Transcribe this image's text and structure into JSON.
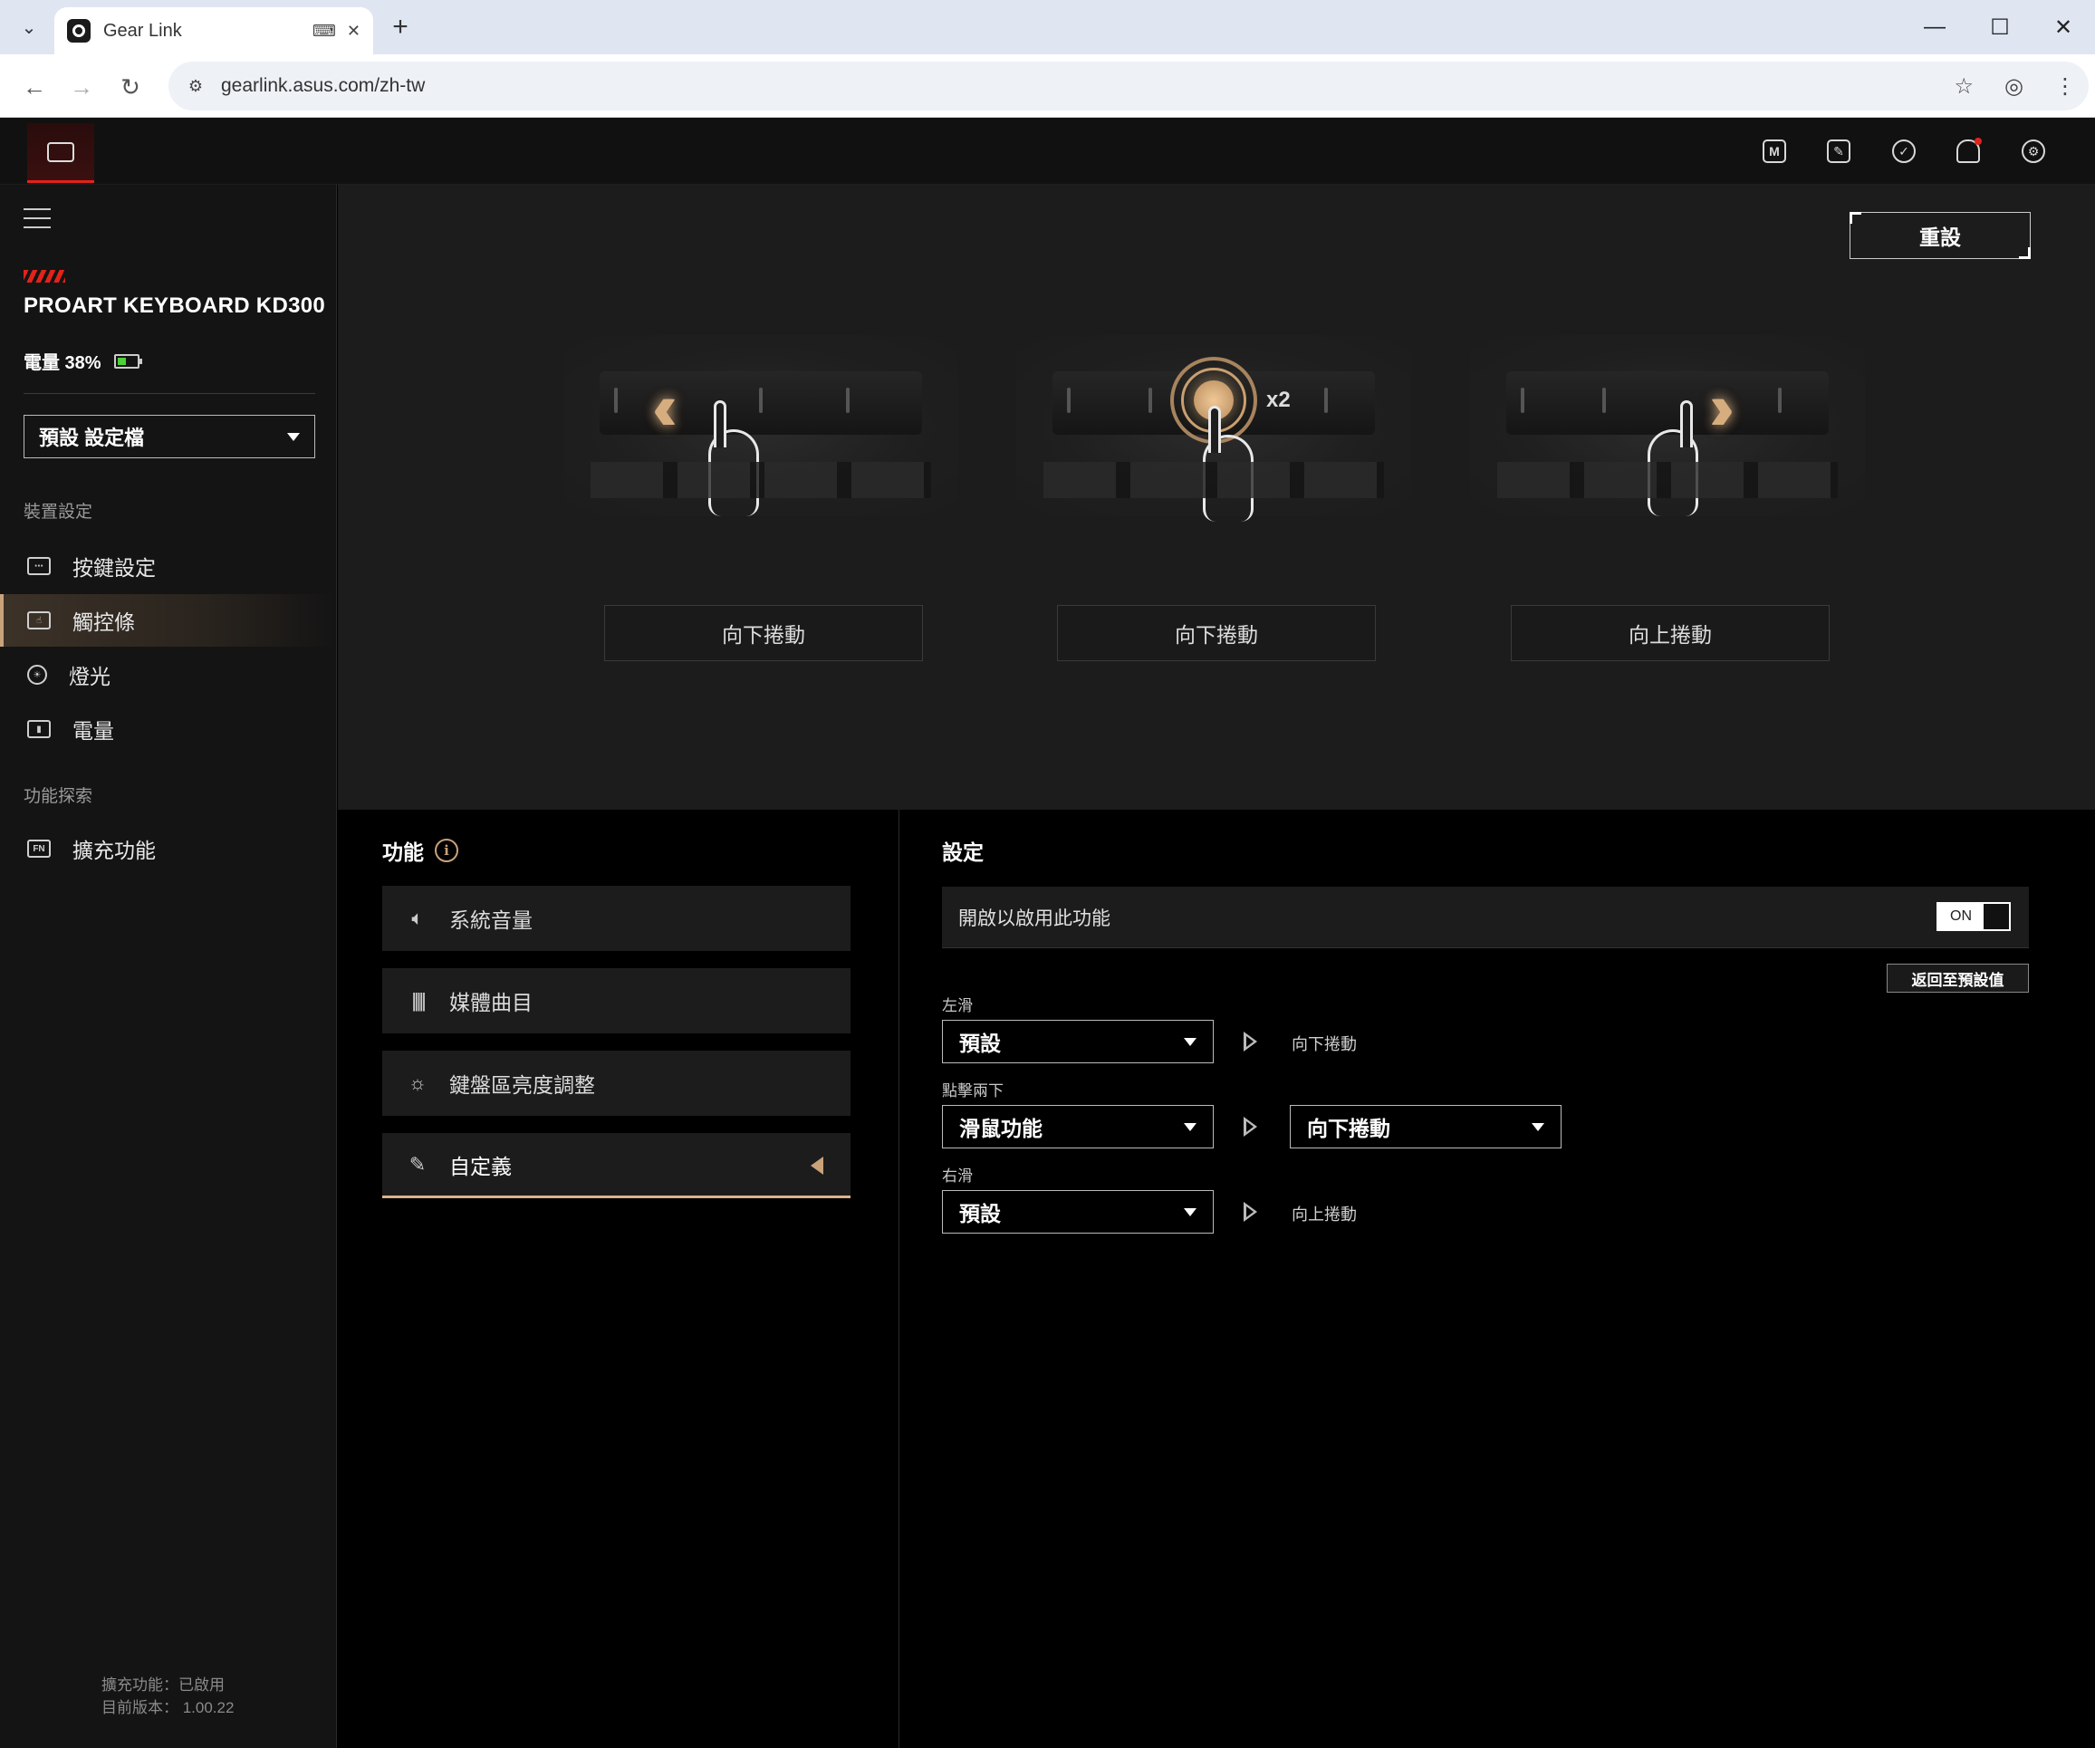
{
  "browser": {
    "tab_title": "Gear Link",
    "url": "gearlink.asus.com/zh-tw",
    "new_tab": "+",
    "minimize": "—",
    "maximize": "☐",
    "close": "✕"
  },
  "header": {
    "icons": [
      "macro-icon",
      "edit-icon",
      "sync-icon",
      "bell-icon",
      "gear-icon"
    ],
    "notification_dot": true
  },
  "sidebar": {
    "device_name": "PROART KEYBOARD KD300",
    "battery_text": "電量 38%",
    "battery_level": 0.38,
    "profile": "預設 設定檔",
    "section_device": "裝置設定",
    "items": [
      {
        "label": "按鍵設定",
        "icon": "keyboard-icon"
      },
      {
        "label": "觸控條",
        "icon": "touchbar-icon",
        "active": true
      },
      {
        "label": "燈光",
        "icon": "light-icon"
      },
      {
        "label": "電量",
        "icon": "battery-icon"
      }
    ],
    "section_explore": "功能探索",
    "explore_items": [
      {
        "label": "擴充功能",
        "icon": "fn-icon"
      }
    ],
    "footer_line1": "擴充功能：已啟用",
    "footer_line2": "目前版本： 1.00.22"
  },
  "top_panel": {
    "reset_label": "重設",
    "gestures": [
      {
        "label": "向下捲動",
        "type": "swipe-left"
      },
      {
        "label": "向下捲動",
        "type": "double-tap",
        "badge": "x2"
      },
      {
        "label": "向上捲動",
        "type": "swipe-right"
      }
    ]
  },
  "functions": {
    "title": "功能",
    "items": [
      {
        "label": "系統音量",
        "icon": "volume-icon"
      },
      {
        "label": "媒體曲目",
        "icon": "media-track-icon"
      },
      {
        "label": "鍵盤區亮度調整",
        "icon": "brightness-icon"
      },
      {
        "label": "自定義",
        "icon": "custom-edit-icon",
        "active": true
      }
    ]
  },
  "settings": {
    "title": "設定",
    "enable_label": "開啟以啟用此功能",
    "toggle_state": "ON",
    "restore_label": "返回至預設值",
    "rows": [
      {
        "label": "左滑",
        "select": "預設",
        "result": "向下捲動"
      },
      {
        "label": "點擊兩下",
        "select": "滑鼠功能",
        "result_select": "向下捲動"
      },
      {
        "label": "右滑",
        "select": "預設",
        "result": "向上捲動"
      }
    ]
  },
  "colors": {
    "accent": "#c9a27a",
    "brand_red": "#e2231a",
    "panel": "#1c1c1c"
  }
}
